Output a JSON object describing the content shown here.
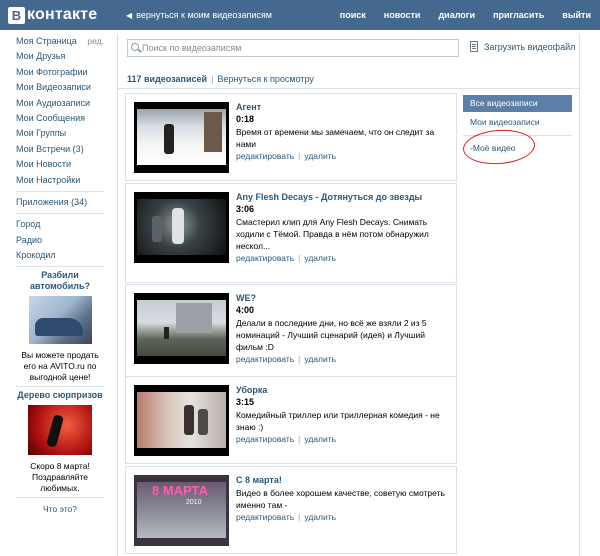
{
  "header": {
    "logo_letter": "В",
    "logo_text": "контакте",
    "back_link": "вернуться к моим видеозаписям",
    "nav": [
      "поиск",
      "новости",
      "диалоги",
      "пригласить",
      "выйти"
    ],
    "bg_color": "#45688e"
  },
  "left_menu": {
    "items": [
      "Моя Страница",
      "Мои Друзья",
      "Мои Фотографии",
      "Мои Видеозаписи",
      "Мои Аудиозаписи",
      "Мои Сообщения",
      "Мои Группы",
      "Мои Встречи (3)",
      "Мои Новости",
      "Мои Настройки"
    ],
    "edit_label": "ред.",
    "apps": "Приложения (34)",
    "extra": [
      "Город",
      "Радио",
      "Крокодил"
    ]
  },
  "ads": [
    {
      "title": "Разбили автомобиль?",
      "text": "Вы можете продать его на AVITO.ru по выгодной цене!",
      "icon": "crashed-car-image"
    },
    {
      "title": "Дерево сюрпризов",
      "text": "Скоро 8 марта! Поздравляйте любимых.",
      "icon": "dancing-couple-image"
    }
  ],
  "ad_footer": "Что это?",
  "search": {
    "placeholder": "Поиск по видеозаписям",
    "value": ""
  },
  "upload_label": "Загрузить видеофайл",
  "count_label": "117 видеозаписей",
  "back_to_browse": "Вернуться к просмотру",
  "videos": [
    {
      "title": "Агент",
      "duration": "0:18",
      "description": "Время от времени мы замечаем, что он следит за нами",
      "edit": "редактировать",
      "delete": "удалить"
    },
    {
      "title": "Any Flesh Decays - Дотянуться до звезды",
      "duration": "3:06",
      "description": "Смастерил клип для Any Flesh Decays. Снимать ходили с Тёмой. Правда в нём потом обнаружил нескол...",
      "edit": "редактировать",
      "delete": "удалить"
    },
    {
      "title": "WE?",
      "duration": "4:00",
      "description": "Делали в последние дни, но всё же взяли 2 из 5 номинаций - Лучший сценарий (идея) и Лучший фильм :D",
      "edit": "редактировать",
      "delete": "удалить"
    },
    {
      "title": "Уборка",
      "duration": "3:15",
      "description": "Комедийный триллер или триллерная комедия - не знаю :)",
      "edit": "редактировать",
      "delete": "удалить"
    },
    {
      "title": "С 8 марта!",
      "duration": "",
      "description": "Видео в более хорошем качестве, советую смотреть именно там -",
      "edit": "редактировать",
      "delete": "удалить",
      "thumb_text": "8 МАРТА",
      "thumb_year": "2010"
    }
  ],
  "right": {
    "all_videos": "Все видеозаписи",
    "my_videos": "Мои видеозаписи",
    "album": "-Моё видео"
  }
}
